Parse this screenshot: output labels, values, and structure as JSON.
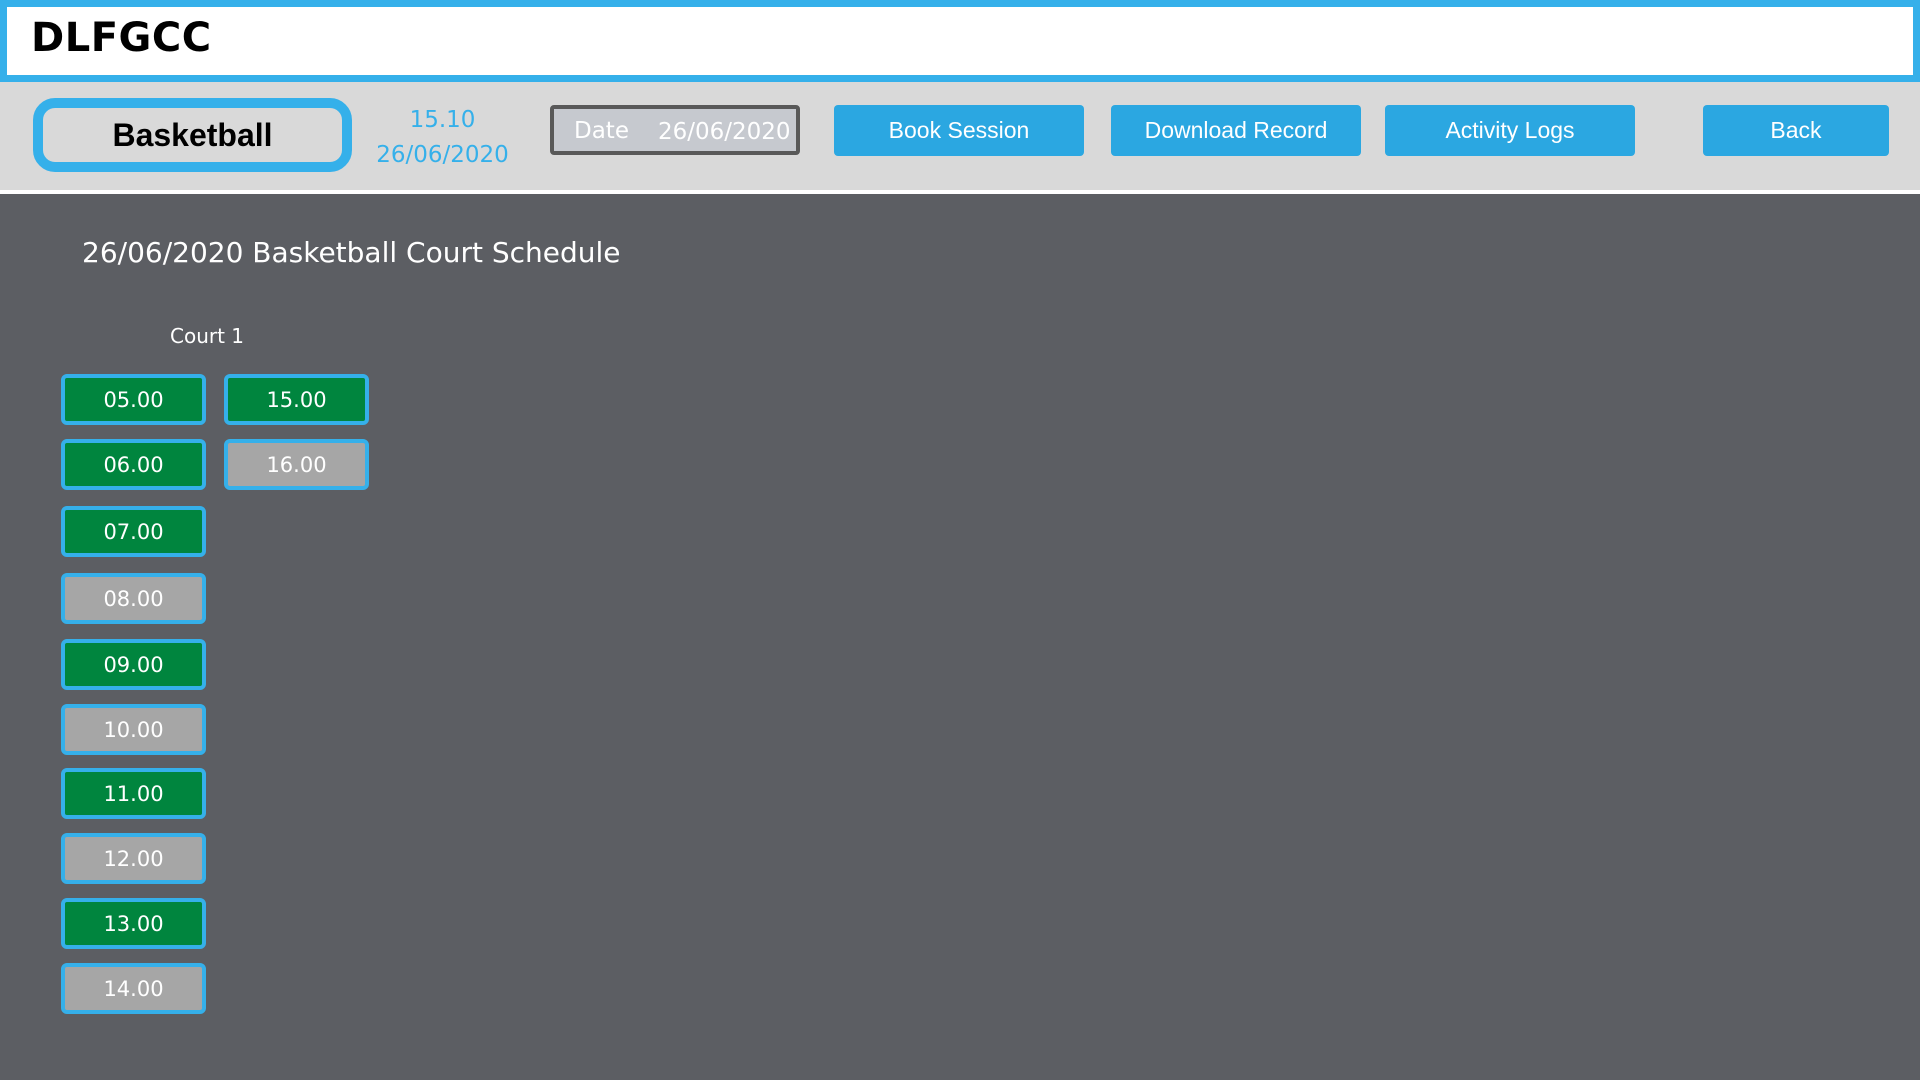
{
  "app": {
    "title": "DLFGCC"
  },
  "toolbar": {
    "activity": "Basketball",
    "clock_time": "15.10",
    "clock_date": "26/06/2020",
    "date_label": "Date",
    "date_value": "26/06/2020",
    "book_session_label": "Book Session",
    "download_record_label": "Download Record",
    "activity_logs_label": "Activity Logs",
    "back_label": "Back"
  },
  "schedule": {
    "title": "26/06/2020 Basketball Court Schedule",
    "court_label": "Court 1",
    "slots": [
      {
        "time": "05.00",
        "status": "available"
      },
      {
        "time": "06.00",
        "status": "available"
      },
      {
        "time": "07.00",
        "status": "available"
      },
      {
        "time": "08.00",
        "status": "booked"
      },
      {
        "time": "09.00",
        "status": "available"
      },
      {
        "time": "10.00",
        "status": "booked"
      },
      {
        "time": "11.00",
        "status": "available"
      },
      {
        "time": "12.00",
        "status": "booked"
      },
      {
        "time": "13.00",
        "status": "available"
      },
      {
        "time": "14.00",
        "status": "booked"
      },
      {
        "time": "15.00",
        "status": "available"
      },
      {
        "time": "16.00",
        "status": "booked"
      }
    ]
  },
  "colors": {
    "accent": "#35b0ea",
    "available": "#00853e",
    "booked": "#a6a6a6",
    "background": "#5c5e63"
  }
}
